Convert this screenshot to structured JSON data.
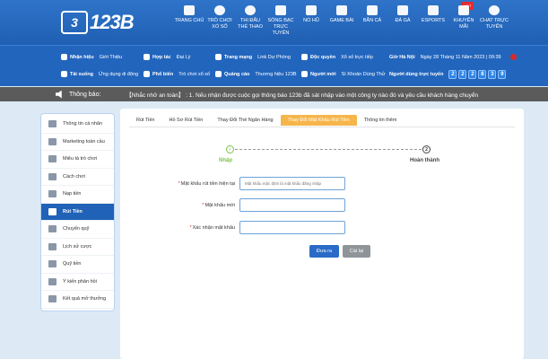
{
  "brand": {
    "logo_mark": "3",
    "logo_text": "123B"
  },
  "nav": [
    {
      "icon": "home-icon",
      "label": "TRANG CHỦ",
      "sub": ""
    },
    {
      "icon": "lottery-icon",
      "label": "TRÒ CHƠI",
      "sub": "XỔ SỐ"
    },
    {
      "icon": "sport-icon",
      "label": "THI ĐẤU",
      "sub": "THỂ THAO"
    },
    {
      "icon": "casino-icon",
      "label": "SÒNG BẠC",
      "sub": "TRỰC TUYẾN"
    },
    {
      "icon": "slot-icon",
      "label": "NỔ HŨ",
      "sub": ""
    },
    {
      "icon": "gamepad-icon",
      "label": "GAME BÀI",
      "sub": ""
    },
    {
      "icon": "fish-icon",
      "label": "BẮN CÁ",
      "sub": ""
    },
    {
      "icon": "cock-icon",
      "label": "ĐÁ GÀ",
      "sub": ""
    },
    {
      "icon": "esports-icon",
      "label": "ESPORTS",
      "sub": ""
    },
    {
      "icon": "gift-icon",
      "label": "KHUYẾN MÃI",
      "sub": "",
      "badge": "HOT"
    },
    {
      "icon": "support-icon",
      "label": "CHAT TRỰC",
      "sub": "TUYẾN"
    }
  ],
  "subbar": {
    "col1": [
      {
        "main": "Nhận hiệu",
        "extra": "Giới Thiệu"
      },
      {
        "main": "Tải xuống",
        "extra": "Ứng dụng di động"
      }
    ],
    "col2": [
      {
        "main": "Hợp tác",
        "extra": "Đại Lý"
      },
      {
        "main": "Phổ biến",
        "extra": "Trò chơi xổ số"
      }
    ],
    "col3": [
      {
        "main": "Trang mạng",
        "extra": "Link Dự Phòng"
      },
      {
        "main": "Quảng cáo",
        "extra": "Thương hiệu 123B"
      }
    ],
    "col4": [
      {
        "main": "Độc quyền",
        "extra": "Xổ số trực tiếp"
      },
      {
        "main": "Người mới",
        "extra": "Sì Khoản Dùng Thử"
      }
    ],
    "time_label": "Giờ Hà Nội",
    "date": "Ngày 28 Tháng 11 Năm 2023 | 09:39",
    "users_label": "Người dùng trực tuyến",
    "users_digits": [
      "2",
      "2",
      "2",
      "8",
      "3",
      "9"
    ]
  },
  "notice": {
    "label": "Thông báo:",
    "text": "【Nhắc nhở an toàn】 :   1. Nếu nhận được cuộc gọi thông báo 123b đã sát nhập vào một công ty nào đó và yêu cầu khách hàng chuyển"
  },
  "sidebar": {
    "items": [
      {
        "icon": "profile-icon",
        "label": "Thông tin cá nhân",
        "active": false
      },
      {
        "icon": "diamond-icon",
        "label": "Marketing toàn cầu",
        "active": false
      },
      {
        "icon": "gamepad-icon",
        "label": "Miêu tả trò chơi",
        "active": false
      },
      {
        "icon": "clock-icon",
        "label": "Cách chơi",
        "active": false
      },
      {
        "icon": "deposit-icon",
        "label": "Nạp tiền",
        "active": false
      },
      {
        "icon": "withdraw-icon",
        "label": "Rút Tiền",
        "active": true
      },
      {
        "icon": "transfer-icon",
        "label": "Chuyển quỹ",
        "active": false
      },
      {
        "icon": "history-icon",
        "label": "Lịch sử cược",
        "active": false
      },
      {
        "icon": "fund-icon",
        "label": "Quỹ tiền",
        "active": false
      },
      {
        "icon": "feedback-icon",
        "label": "Ý kiến phản hồi",
        "active": false
      },
      {
        "icon": "result-icon",
        "label": "Kết quả mở thưởng",
        "active": false
      }
    ]
  },
  "tabs": [
    {
      "label": "Rút Tiền",
      "active": false
    },
    {
      "label": "Hồ Sơ Rút Tiền",
      "active": false
    },
    {
      "label": "Thay Đổi Thẻ Ngân Hàng",
      "active": false
    },
    {
      "label": "Thay Đổi Mật Khẩu Rút Tiền",
      "active": true
    },
    {
      "label": "Thông tin thêm",
      "active": false
    }
  ],
  "steps": {
    "step1_mark": "✓",
    "step1_label": "Nhập",
    "step2_mark": "2",
    "step2_label": "Hoàn thành"
  },
  "form": {
    "current_label": "Mật khẩu rút tiền hiện tại",
    "current_placeholder": "Mật khẩu mặc định là mật khẩu đăng nhập",
    "new_label": "Mật khẩu mới",
    "new_placeholder": "",
    "confirm_label": "Xác nhận mật khẩu",
    "confirm_placeholder": "",
    "submit": "Đưa ra",
    "reset": "Cài lại"
  },
  "colors": {
    "header": "#2f74c9",
    "active_tab": "#f6b54b",
    "step_done": "#7cc24b",
    "sidebar_active": "#1f62b8",
    "submit": "#2a6bc7",
    "reset": "#8f9499"
  }
}
